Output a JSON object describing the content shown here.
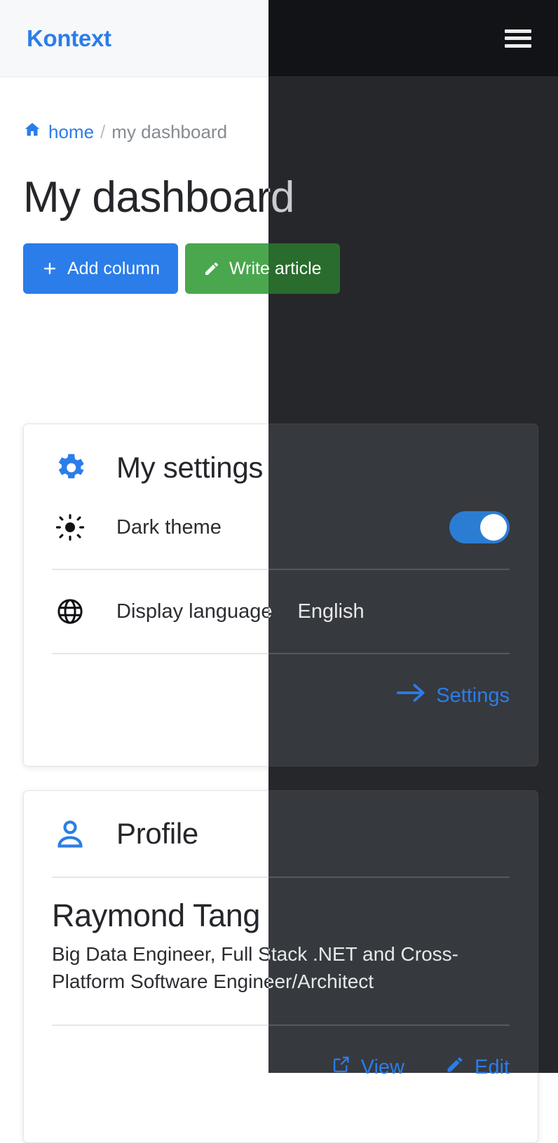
{
  "header": {
    "logo": "Kontext",
    "menu_icon": "hamburger-menu-icon"
  },
  "breadcrumb": {
    "home_label": "home",
    "separator": "/",
    "current_label": "my dashboard",
    "home_icon": "home-icon"
  },
  "page_title": "My dashboard",
  "actions": {
    "add_column": {
      "label": "Add column",
      "icon": "plus-icon"
    },
    "write_article": {
      "label": "Write article",
      "icon": "pencil-icon"
    }
  },
  "cards": {
    "settings": {
      "title": "My settings",
      "icon": "gear-icon",
      "rows": [
        {
          "icon": "sun-icon",
          "label": "Dark theme",
          "control": "toggle",
          "value": "on"
        },
        {
          "icon": "globe-icon",
          "label": "Display language",
          "value": "English"
        }
      ],
      "footer_link": {
        "label": "Settings",
        "icon": "arrow-right-icon"
      }
    },
    "profile": {
      "title": "Profile",
      "icon": "person-icon",
      "name": "Raymond Tang",
      "bio": "Big Data Engineer, Full Stack .NET and Cross-Platform Software Engineer/Architect",
      "footer_links": [
        {
          "label": "View",
          "icon": "external-link-icon"
        },
        {
          "label": "Edit",
          "icon": "pencil-icon"
        }
      ]
    }
  },
  "colors": {
    "accent_blue": "#2b7de9",
    "success_green": "#4aa74e",
    "light_bg": "#ffffff",
    "light_header_bg": "#f7f8fa",
    "dark_bg": "#25272b",
    "dark_header_bg": "#121317",
    "dark_card_bg": "#36393e"
  }
}
